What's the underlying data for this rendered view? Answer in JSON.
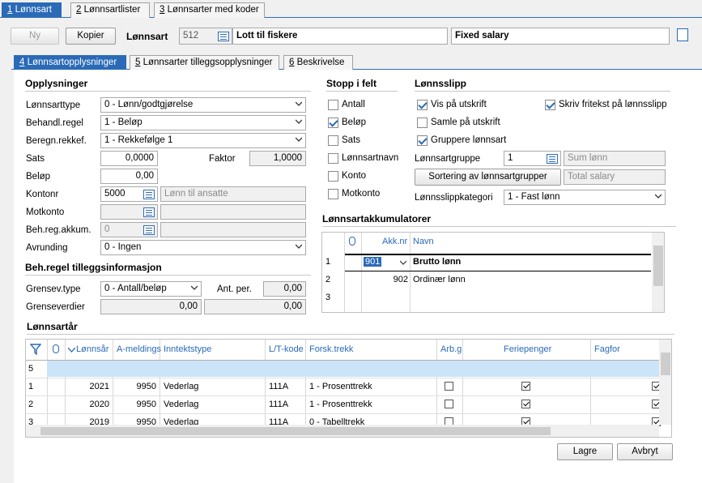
{
  "top_tabs": [
    {
      "key": "1",
      "label": "Lønnsart",
      "active": true
    },
    {
      "key": "2",
      "label": "Lønnsartlister",
      "active": false
    },
    {
      "key": "3",
      "label": "Lønnsarter med koder",
      "active": false
    }
  ],
  "toolbar": {
    "new_label": "Ny",
    "copy_label": "Kopier",
    "field_label": "Lønnsart",
    "number": "512",
    "name": "Lott til fiskere",
    "english_name": "Fixed salary"
  },
  "sub_tabs": [
    {
      "key": "4",
      "label": "Lønnsartopplysninger",
      "active": true
    },
    {
      "key": "5",
      "label": "Lønnsarter tilleggsopplysninger",
      "active": false
    },
    {
      "key": "6",
      "label": "Beskrivelse",
      "active": false
    }
  ],
  "opplysninger": {
    "heading": "Opplysninger",
    "lonnsarttype_label": "Lønnsarttype",
    "lonnsarttype": "0 - Lønn/godtgjørelse",
    "behandl_label": "Behandl.regel",
    "behandl": "1 - Beløp",
    "beregn_label": "Beregn.rekkef.",
    "beregn": "1 - Rekkefølge 1",
    "sats_label": "Sats",
    "sats": "0,0000",
    "faktor_label": "Faktor",
    "faktor": "1,0000",
    "belop_label": "Beløp",
    "belop": "0,00",
    "kontonr_label": "Kontonr",
    "kontonr": "5000",
    "kontonr_name": "Lønn til ansatte",
    "motkonto_label": "Motkonto",
    "motkonto": "",
    "behreg_label": "Beh.reg.akkum.",
    "behreg": "0",
    "avrunding_label": "Avrunding",
    "avrunding": "0 - Ingen"
  },
  "tillegg": {
    "heading": "Beh.regel tilleggsinformasjon",
    "grensev_label": "Grensev.type",
    "grensev": "0 - Antall/beløp",
    "antper_label": "Ant. per.",
    "antper": "0,00",
    "grenseverdier_label": "Grenseverdier",
    "grense1": "0,00",
    "grense2": "0,00"
  },
  "stopp": {
    "heading": "Stopp i felt",
    "items": [
      {
        "label": "Antall",
        "checked": false
      },
      {
        "label": "Beløp",
        "checked": true
      },
      {
        "label": "Sats",
        "checked": false
      },
      {
        "label": "Lønnsartnavn",
        "checked": false
      },
      {
        "label": "Konto",
        "checked": false
      },
      {
        "label": "Motkonto",
        "checked": false
      }
    ]
  },
  "lonnsslipp": {
    "heading": "Lønnsslipp",
    "vis_label": "Vis på utskrift",
    "vis": true,
    "skriv_label": "Skriv fritekst på lønnsslipp",
    "skriv": true,
    "samle_label": "Samle på utskrift",
    "samle": false,
    "grupper_label": "Gruppere lønnsart",
    "grupper": true,
    "gruppe_label": "Lønnsartgruppe",
    "gruppe": "1",
    "gruppe_name": "Sum lønn",
    "sortering_label": "Sortering av lønnsartgrupper",
    "sortering_name": "Total salary",
    "kategori_label": "Lønnsslippkategori",
    "kategori": "1 - Fast lønn"
  },
  "akkumulatorer": {
    "heading": "Lønnsartakkumulatorer",
    "col_akk": "Akk.nr",
    "col_navn": "Navn",
    "rows": [
      {
        "n": "1",
        "akk": "901",
        "navn": "Brutto lønn"
      },
      {
        "n": "2",
        "akk": "902",
        "navn": "Ordinær lønn"
      },
      {
        "n": "3",
        "akk": "",
        "navn": ""
      }
    ]
  },
  "lonnsar": {
    "heading": "Lønnsartår",
    "columns": [
      "Lønnsår",
      "A-meldings",
      "Inntektstype",
      "L/T-kode",
      "Forsk.trekk",
      "Arb.g",
      "Feriepenger",
      "Fagfor"
    ],
    "new_row": "5",
    "rows": [
      {
        "n": "1",
        "ar": "2021",
        "am": "9950",
        "inntekt": "Vederlag",
        "lt": "111A",
        "forsk": "1 - Prosenttrekk",
        "arbg": false,
        "ferie": true,
        "fag": true
      },
      {
        "n": "2",
        "ar": "2020",
        "am": "9950",
        "inntekt": "Vederlag",
        "lt": "111A",
        "forsk": "1 - Prosenttrekk",
        "arbg": false,
        "ferie": true,
        "fag": true
      },
      {
        "n": "3",
        "ar": "2019",
        "am": "9950",
        "inntekt": "Vederlag",
        "lt": "111A",
        "forsk": "0 - Tabelltrekk",
        "arbg": false,
        "ferie": true,
        "fag": true
      }
    ]
  },
  "footer": {
    "save_label": "Lagre",
    "cancel_label": "Avbryt"
  },
  "colors": {
    "accent": "#2a6ab7",
    "selected_row": "#cce4f7"
  }
}
